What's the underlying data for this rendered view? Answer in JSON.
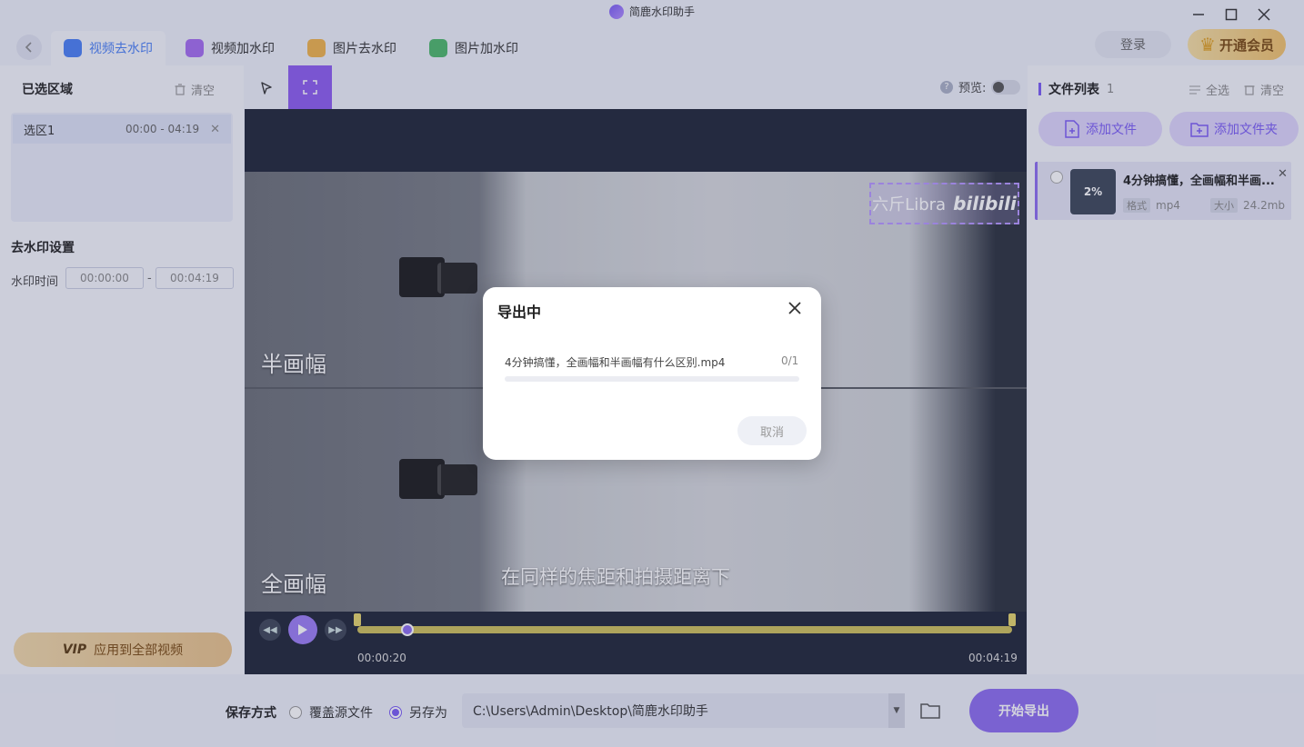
{
  "window": {
    "title": "简鹿水印助手",
    "minimize_icon": "minimize-icon",
    "maximize_icon": "maximize-icon",
    "close_icon": "close-icon"
  },
  "nav": {
    "tabs": [
      {
        "label": "视频去水印",
        "active": true,
        "icon": "video-remove-icon",
        "color": "#4a7ff5"
      },
      {
        "label": "视频加水印",
        "active": false,
        "icon": "video-add-icon",
        "color": "#a56cf0"
      },
      {
        "label": "图片去水印",
        "active": false,
        "icon": "image-remove-icon",
        "color": "#f0b24a"
      },
      {
        "label": "图片加水印",
        "active": false,
        "icon": "image-add-icon",
        "color": "#4cb86a"
      }
    ],
    "login_label": "登录",
    "vip_label": "开通会员"
  },
  "left_panel": {
    "selected_title": "已选区域",
    "clear_label": "清空",
    "regions": [
      {
        "name": "选区1",
        "range": "00:00 - 04:19"
      }
    ],
    "settings_title": "去水印设置",
    "time_label": "水印时间",
    "time_start": "00:00:00",
    "time_end": "00:04:19",
    "time_separator": "-",
    "apply_vip_tag": "VIP",
    "apply_label": "应用到全部视频"
  },
  "toolbar": {
    "preview_label": "预览:",
    "preview_on": false
  },
  "video": {
    "caption_top": "半画幅",
    "caption_bottom": "全画幅",
    "subtitle": "在同样的焦距和拍摄距离下",
    "watermark_text": "六斤Libra",
    "watermark_logo": "bilibili",
    "current_time": "00:00:20",
    "total_time": "00:04:19",
    "progress": 0.077
  },
  "right_panel": {
    "title": "文件列表",
    "count": "1",
    "select_all_label": "全选",
    "clear_label": "清空",
    "add_file_label": "添加文件",
    "add_folder_label": "添加文件夹",
    "files": [
      {
        "name": "4分钟搞懂，全画幅和半画...",
        "progress_text": "2%",
        "format_tag": "格式",
        "format": "mp4",
        "size_tag": "大小",
        "size": "24.2mb"
      }
    ]
  },
  "bottom": {
    "save_mode_label": "保存方式",
    "overwrite_label": "覆盖源文件",
    "save_as_label": "另存为",
    "save_as_selected": true,
    "path": "C:\\Users\\Admin\\Desktop\\简鹿水印助手",
    "export_label": "开始导出"
  },
  "modal": {
    "title": "导出中",
    "file_name": "4分钟搞懂，全画幅和半画幅有什么区别.mp4",
    "count": "0/1",
    "progress": 0.0,
    "cancel_label": "取消"
  },
  "colors": {
    "accent": "#8c6cf0",
    "tab_active": "#4a7ff5",
    "timeline": "#cfc05a"
  }
}
